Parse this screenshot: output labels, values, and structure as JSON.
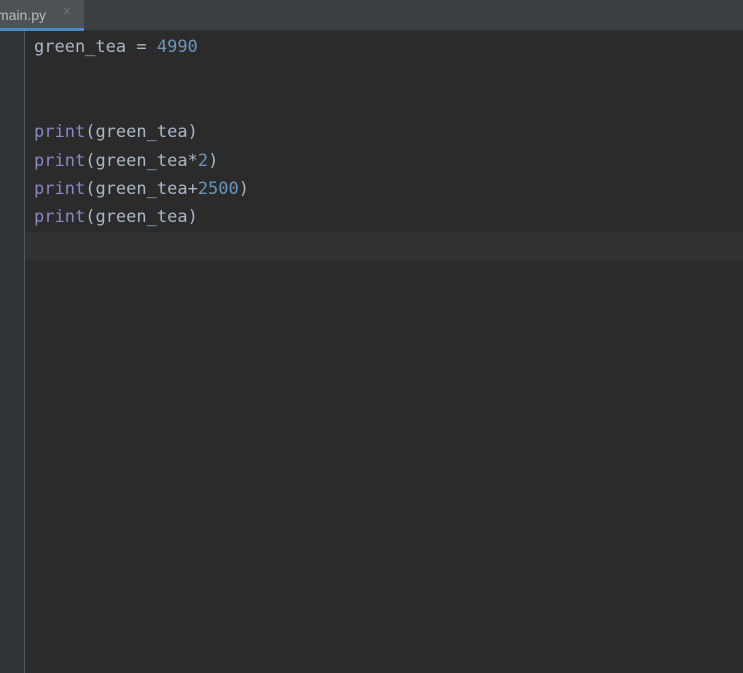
{
  "tab": {
    "filename": "main.py",
    "close_glyph": "×"
  },
  "code": {
    "line1": {
      "ident": "green_tea",
      "op": " = ",
      "num": "4990"
    },
    "line4": {
      "fn": "print",
      "open": "(",
      "ident": "green_tea",
      "close": ")"
    },
    "line5": {
      "fn": "print",
      "open": "(",
      "ident": "green_tea",
      "op": "*",
      "num": "2",
      "close": ")"
    },
    "line6": {
      "fn": "print",
      "open": "(",
      "ident": "green_tea",
      "op": "+",
      "num": "2500",
      "close": ")"
    },
    "line7": {
      "fn": "print",
      "open": "(",
      "ident": "green_tea",
      "close": ")"
    }
  },
  "colors": {
    "editor_bg": "#2b2b2b",
    "tab_accent": "#4a88c7",
    "builtin": "#8888c6",
    "number": "#6897bb",
    "text": "#a9b7c6"
  }
}
